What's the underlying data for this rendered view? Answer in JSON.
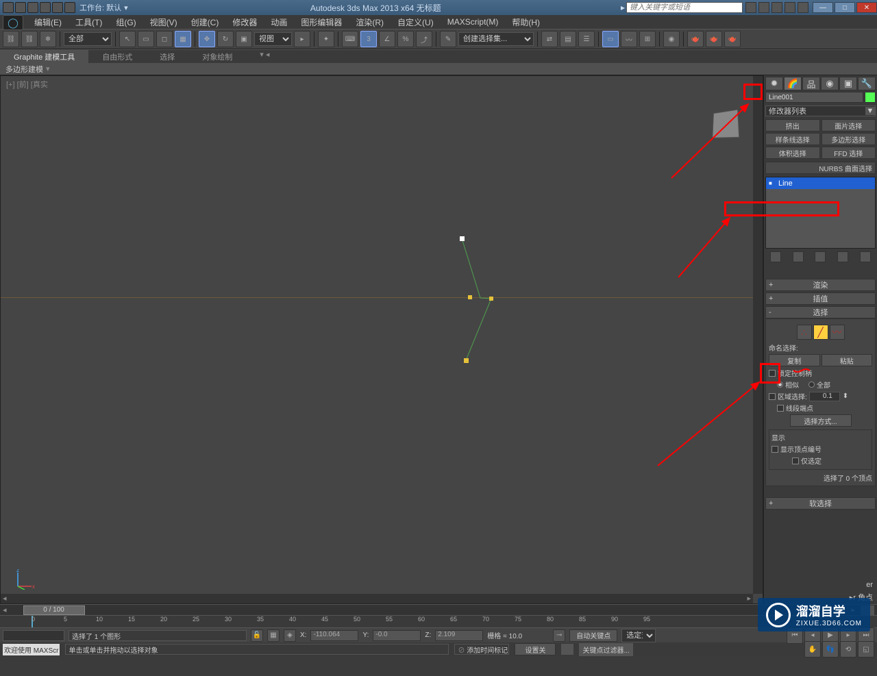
{
  "title": "Autodesk 3ds Max  2013 x64     无标题",
  "workspace_label": "工作台: 默认",
  "search_placeholder": "键入关键字或短语",
  "menu": [
    "编辑(E)",
    "工具(T)",
    "组(G)",
    "视图(V)",
    "创建(C)",
    "修改器",
    "动画",
    "图形编辑器",
    "渲染(R)",
    "自定义(U)",
    "MAXScript(M)",
    "帮助(H)"
  ],
  "toolbar": {
    "filter_all": "全部",
    "coord_view": "视图",
    "named_sel": "创建选择集..."
  },
  "ribbon": {
    "tabs": [
      "Graphite 建模工具",
      "自由形式",
      "选择",
      "对象绘制"
    ],
    "sub": "多边形建模"
  },
  "viewport": {
    "label": "[+] [前] [真实"
  },
  "cmd": {
    "object_name": "Line001",
    "modlist": "修改器列表",
    "modbtns": [
      "挤出",
      "面片选择",
      "样条线选择",
      "多边形选择",
      "体积选择",
      "FFD 选择"
    ],
    "nurbs": "NURBS 曲面选择",
    "stack_item": "Line",
    "rollouts": {
      "render": "渲染",
      "interp": "插值",
      "sel": "选择",
      "soft": "软选择"
    },
    "named_sel_lbl": "命名选择:",
    "copy": "复制",
    "paste": "粘贴",
    "lock_handles": "锁定控制柄",
    "similar": "相似",
    "all": "全部",
    "area_sel": "区域选择:",
    "area_val": "0.1",
    "seg_end": "线段端点",
    "sel_by": "选择方式...",
    "display": "显示",
    "show_vnum": "显示顶点编号",
    "only_sel": "仅选定",
    "sel_count": "选择了 0 个顶点",
    "corner": "角点"
  },
  "timeslider": "0 / 100",
  "ticks": [
    0,
    5,
    10,
    15,
    20,
    25,
    30,
    35,
    40,
    45,
    50,
    55,
    60,
    65,
    70,
    75,
    80,
    85,
    90,
    95
  ],
  "status": {
    "sel": "选择了 1 个图形",
    "prompt": "单击或单击并拖动以选择对象",
    "x": "X:",
    "xval": "-110.064",
    "y": "Y:",
    "yval": "-0.0",
    "z": "Z:",
    "zval": "2.109",
    "grid": "栅格 = 10.0",
    "autokey": "自动关键点",
    "setkey": "设置关",
    "timetag": "添加时间标记",
    "keyfilter": "关键点过滤器...",
    "seldd": "选定对",
    "welcome": "欢迎使用  MAXScr"
  },
  "watermark": {
    "big": "溜溜自学",
    "small": "ZIXUE.3D66.COM"
  }
}
